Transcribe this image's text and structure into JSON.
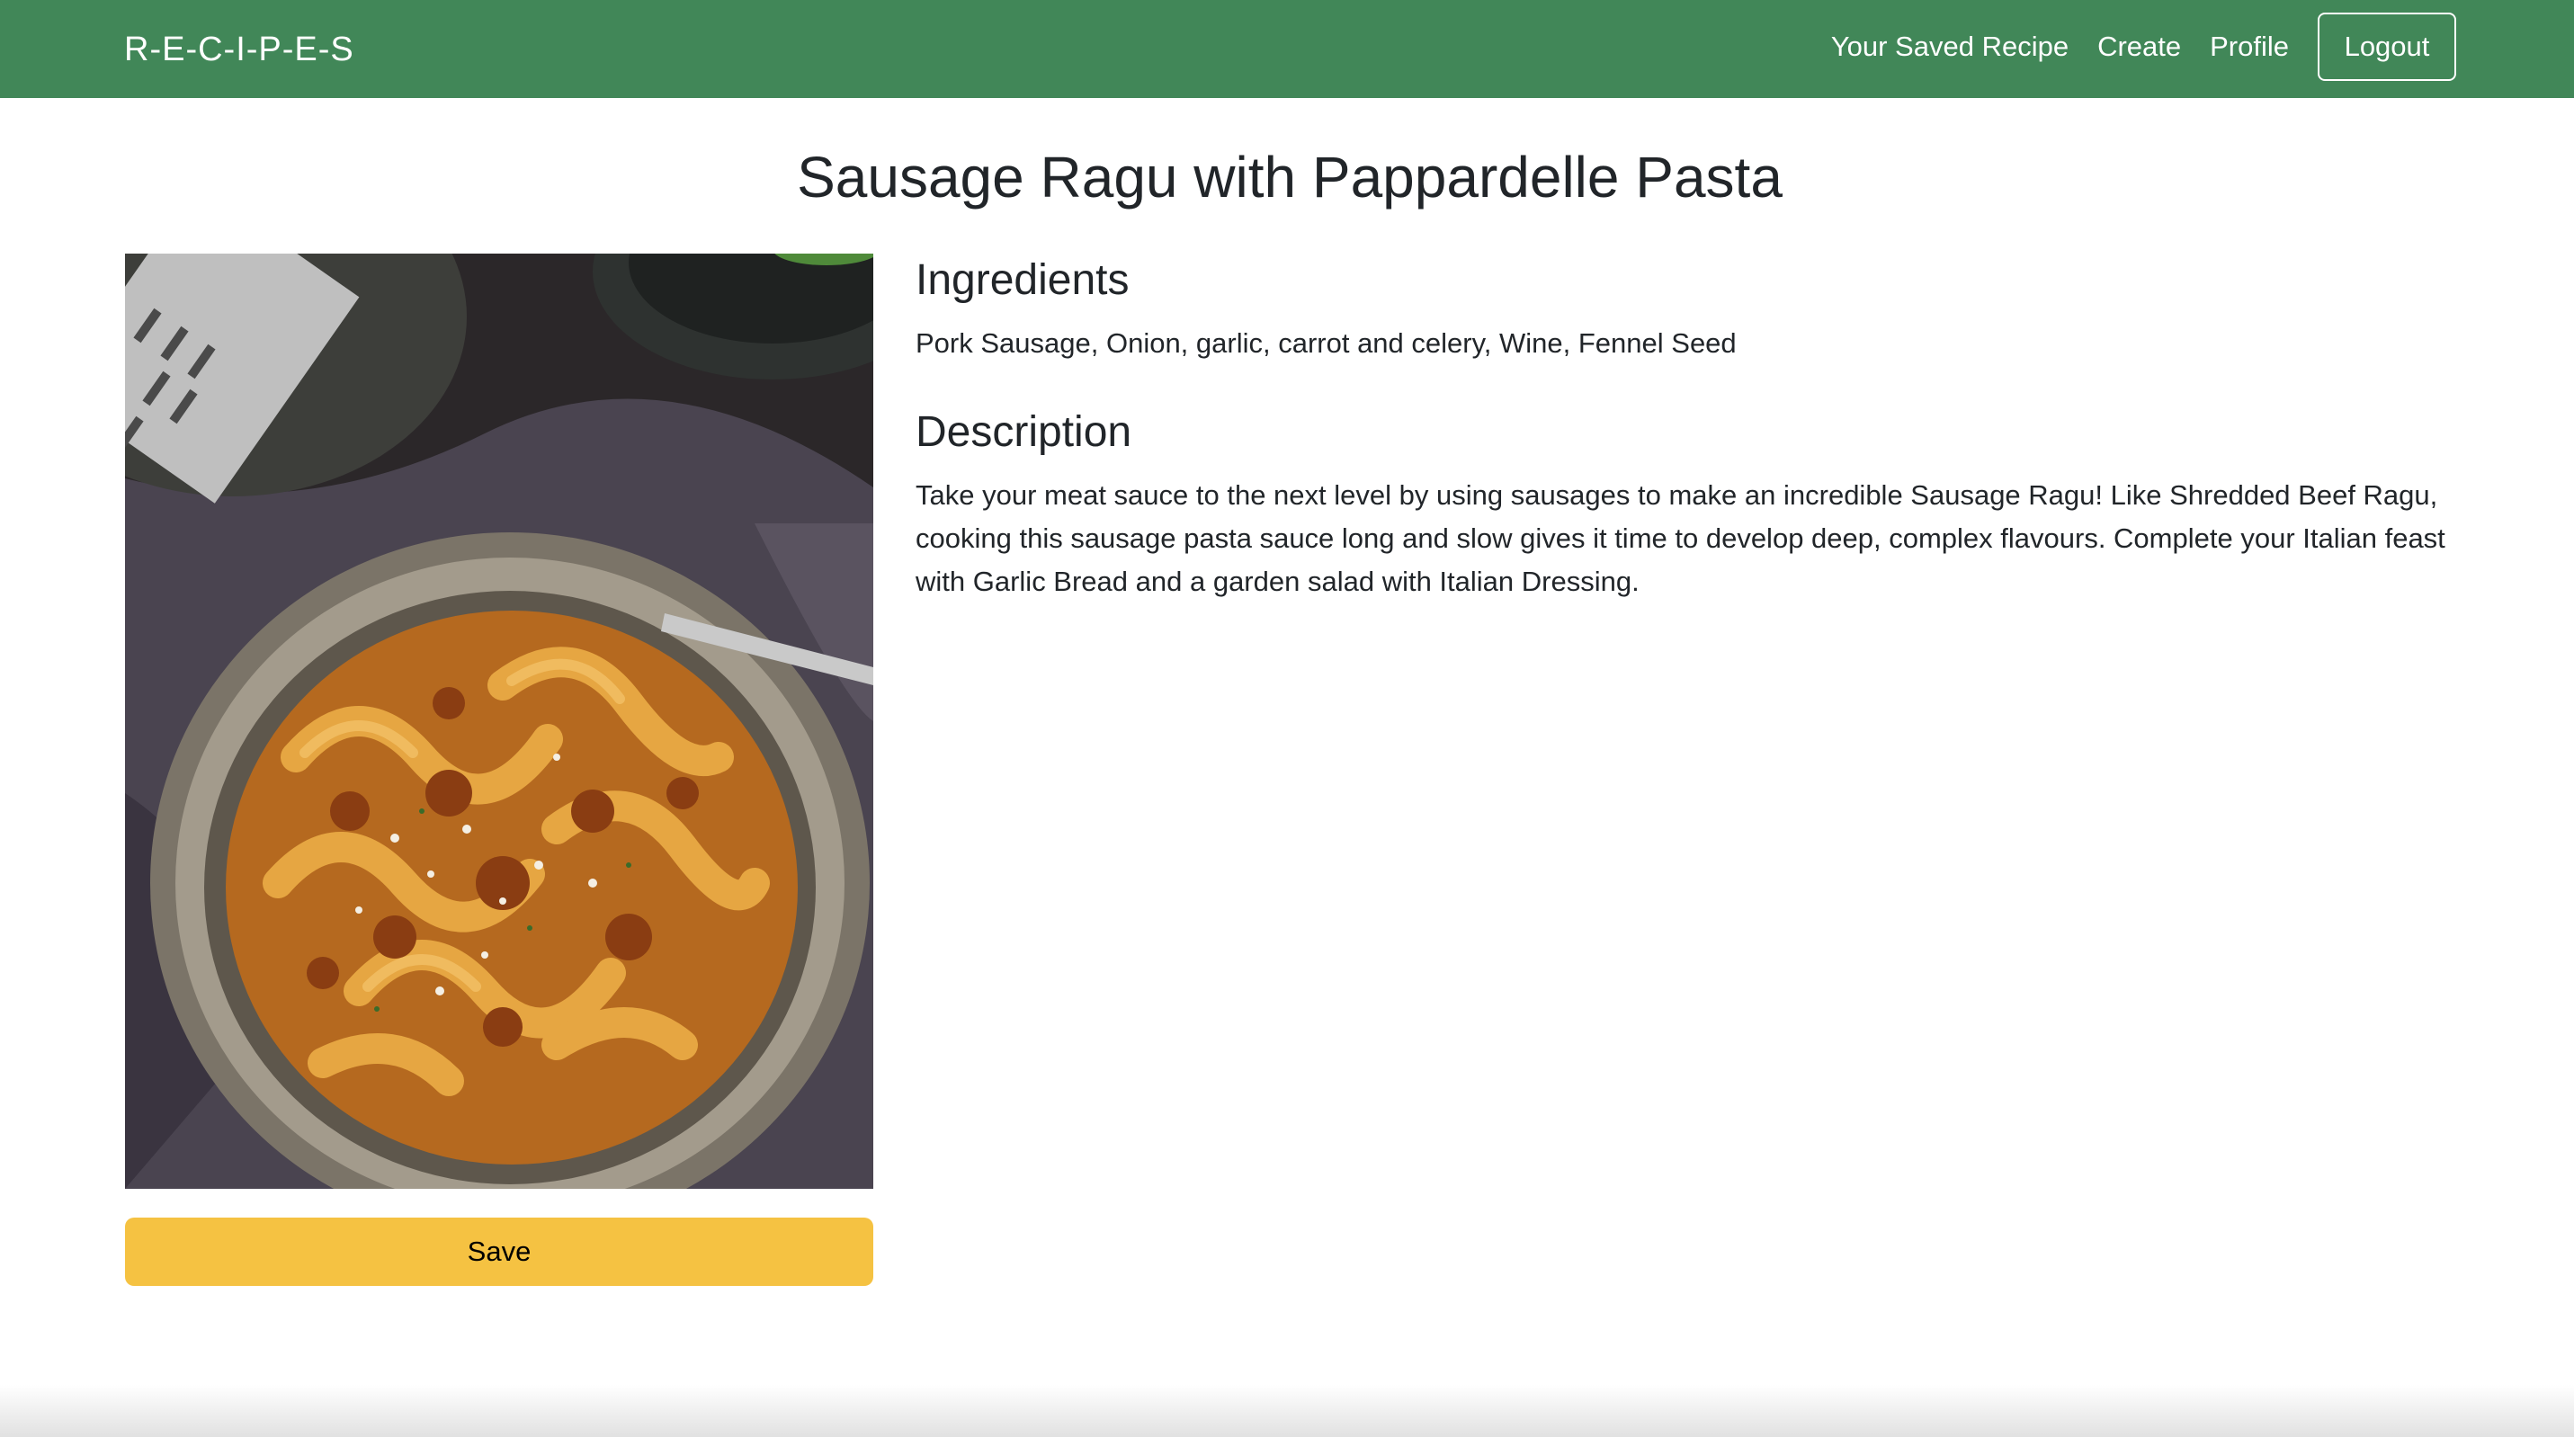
{
  "navbar": {
    "brand": "R-E-C-I-P-E-S",
    "links": [
      "Your Saved Recipe",
      "Create",
      "Profile"
    ],
    "logout_label": "Logout",
    "background_color": "#418758"
  },
  "recipe": {
    "title": "Sausage Ragu with Pappardelle Pasta",
    "ingredients_heading": "Ingredients",
    "ingredients": "Pork Sausage, Onion, garlic, carrot and celery, Wine, Fennel Seed",
    "description_heading": "Description",
    "description": "Take your meat sauce to the next level by using sausages to make an incredible Sausage Ragu! Like Shredded Beef Ragu, cooking this sausage pasta sauce long and slow gives it time to develop deep, complex flavours. Complete your Italian feast with Garlic Bread and a garden salad with Italian Dressing.",
    "save_label": "Save",
    "save_color": "#f5c242"
  }
}
